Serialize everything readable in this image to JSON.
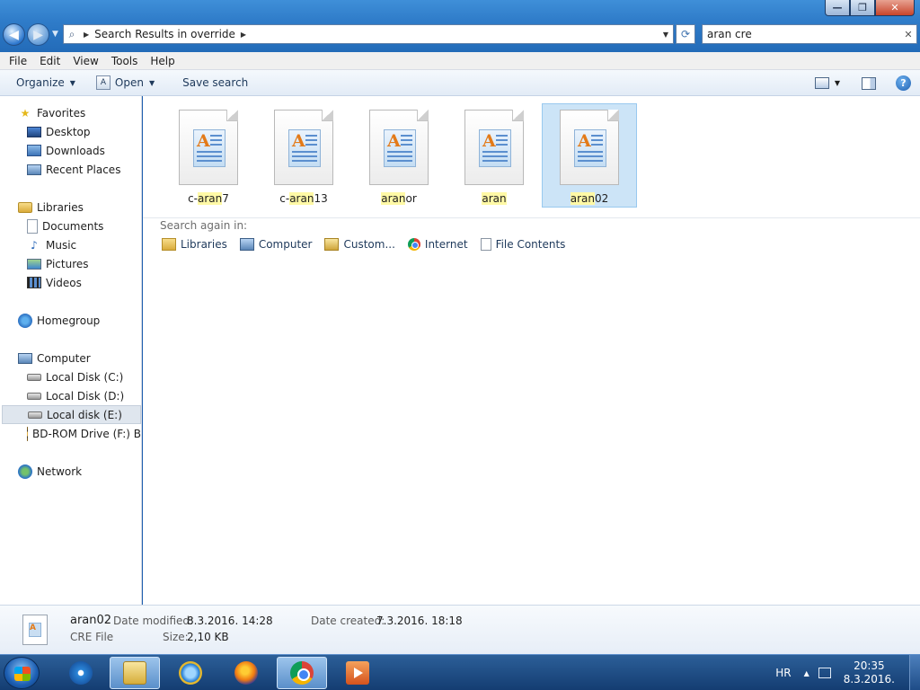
{
  "window": {
    "address_crumb": "Search Results in override",
    "search_query": "aran cre",
    "controls": {
      "minimize": "—",
      "maximize": "❐",
      "close": "✕"
    }
  },
  "menu": [
    "File",
    "Edit",
    "View",
    "Tools",
    "Help"
  ],
  "toolbar": {
    "organize": "Organize",
    "open": "Open",
    "save_search": "Save search"
  },
  "nav": {
    "favorites": {
      "label": "Favorites",
      "items": [
        "Desktop",
        "Downloads",
        "Recent Places"
      ]
    },
    "libraries": {
      "label": "Libraries",
      "items": [
        "Documents",
        "Music",
        "Pictures",
        "Videos"
      ]
    },
    "homegroup": "Homegroup",
    "computer": {
      "label": "Computer",
      "items": [
        "Local Disk (C:)",
        "Local Disk (D:)",
        "Local disk (E:)",
        "BD-ROM Drive (F:) B"
      ]
    },
    "network": "Network"
  },
  "files": [
    {
      "pre": "c-",
      "hl": "aran",
      "post": "7",
      "selected": false
    },
    {
      "pre": "c-",
      "hl": "aran",
      "post": "13",
      "selected": false
    },
    {
      "pre": "",
      "hl": "aran",
      "post": "or",
      "selected": false
    },
    {
      "pre": "",
      "hl": "aran",
      "post": "",
      "selected": false
    },
    {
      "pre": "",
      "hl": "aran",
      "post": "02",
      "selected": true
    }
  ],
  "search_again": {
    "label": "Search again in:",
    "options": [
      "Libraries",
      "Computer",
      "Custom...",
      "Internet",
      "File Contents"
    ]
  },
  "details": {
    "name": "aran02",
    "type": "CRE File",
    "modified_label": "Date modified:",
    "modified": "8.3.2016. 14:28",
    "size_label": "Size:",
    "size": "2,10 KB",
    "created_label": "Date created:",
    "created": "7.3.2016. 18:18"
  },
  "taskbar": {
    "lang": "HR",
    "time": "20:35",
    "date": "8.3.2016."
  },
  "colors": {
    "highlight": "#fff9a6",
    "selection": "#cce4f7",
    "taskbar": "#1f4b84"
  }
}
